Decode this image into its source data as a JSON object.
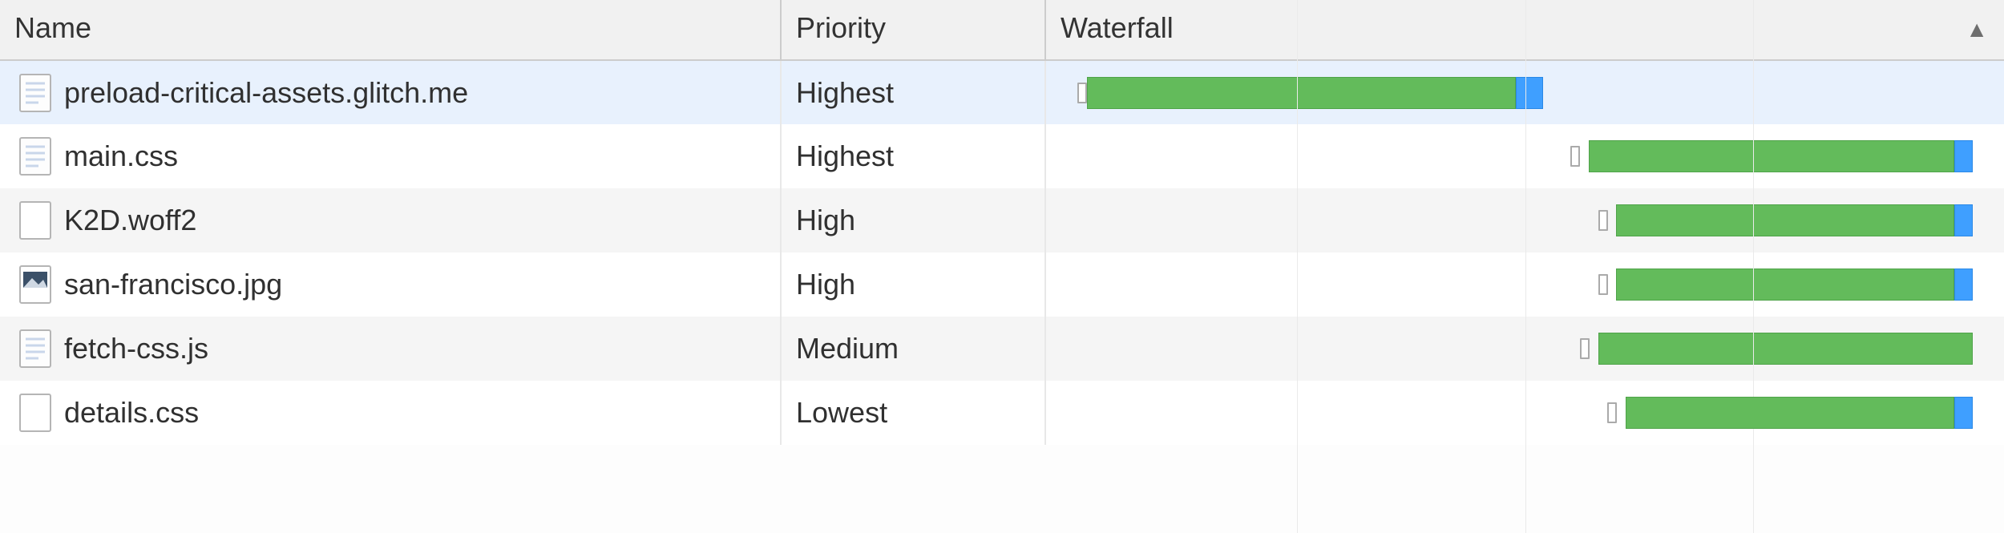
{
  "columns": {
    "name": "Name",
    "priority": "Priority",
    "waterfall": "Waterfall"
  },
  "sort": {
    "column": "waterfall",
    "direction": "asc",
    "glyph": "▲"
  },
  "colors": {
    "bar_green": "#63bb5b",
    "bar_blue": "#3f9fff",
    "selected_row": "#e8f1fd"
  },
  "waterfall": {
    "gridlines_pct": [
      25,
      50,
      75
    ]
  },
  "rows": [
    {
      "name": "preload-critical-assets.glitch.me",
      "priority": "Highest",
      "icon": "doc",
      "selected": true,
      "waterfall": {
        "tick_pct": 1,
        "bar_start_pct": 2,
        "bar_width_pct": 47,
        "tail_width_pct": 3
      }
    },
    {
      "name": "main.css",
      "priority": "Highest",
      "icon": "doc",
      "selected": false,
      "waterfall": {
        "tick_pct": 55,
        "bar_start_pct": 57,
        "bar_width_pct": 40,
        "tail_width_pct": 2
      }
    },
    {
      "name": "K2D.woff2",
      "priority": "High",
      "icon": "blank",
      "selected": false,
      "waterfall": {
        "tick_pct": 58,
        "bar_start_pct": 60,
        "bar_width_pct": 37,
        "tail_width_pct": 2
      }
    },
    {
      "name": "san-francisco.jpg",
      "priority": "High",
      "icon": "image",
      "selected": false,
      "waterfall": {
        "tick_pct": 58,
        "bar_start_pct": 60,
        "bar_width_pct": 37,
        "tail_width_pct": 2
      }
    },
    {
      "name": "fetch-css.js",
      "priority": "Medium",
      "icon": "doc",
      "selected": false,
      "waterfall": {
        "tick_pct": 56,
        "bar_start_pct": 58,
        "bar_width_pct": 41,
        "tail_width_pct": 0
      }
    },
    {
      "name": "details.css",
      "priority": "Lowest",
      "icon": "blank",
      "selected": false,
      "waterfall": {
        "tick_pct": 59,
        "bar_start_pct": 61,
        "bar_width_pct": 36,
        "tail_width_pct": 2
      }
    }
  ]
}
